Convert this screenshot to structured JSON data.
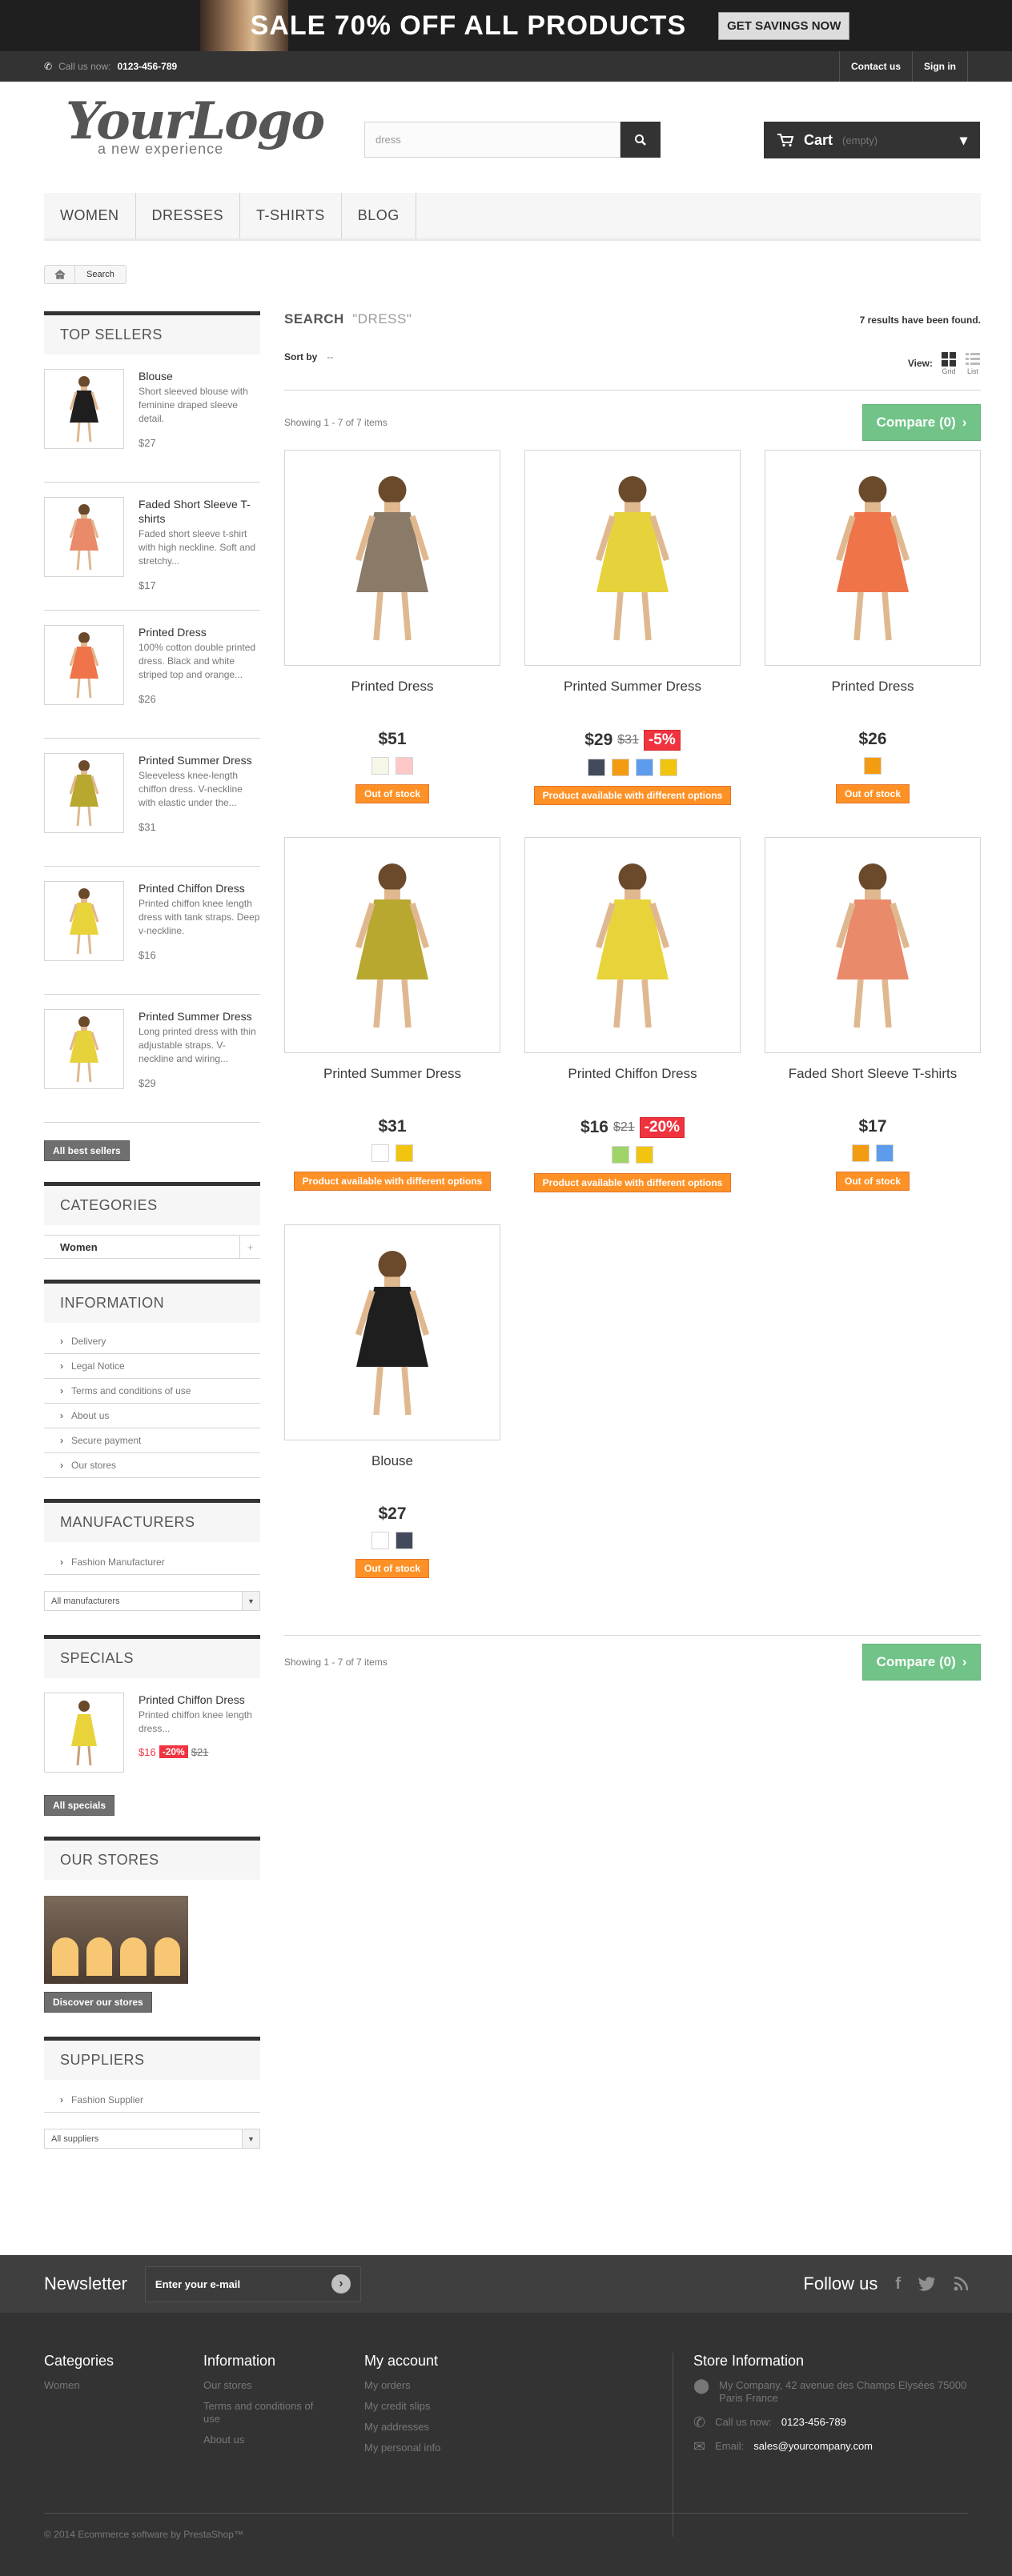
{
  "banner": {
    "text": "SALE 70% OFF ALL PRODUCTS",
    "button": "GET SAVINGS NOW"
  },
  "topbar": {
    "call_label": "Call us now:",
    "phone": "0123-456-789",
    "contact": "Contact us",
    "signin": "Sign in"
  },
  "logo": {
    "main": "YourLogo",
    "tagline": "a new experience"
  },
  "search": {
    "value": "dress"
  },
  "cart": {
    "label": "Cart",
    "status": "(empty)"
  },
  "nav": [
    "WOMEN",
    "DRESSES",
    "T-SHIRTS",
    "BLOG"
  ],
  "breadcrumb": {
    "current": "Search"
  },
  "top_sellers": {
    "title": "TOP SELLERS",
    "button": "All best sellers",
    "items": [
      {
        "name": "Blouse",
        "desc": "Short sleeved blouse with feminine draped sleeve detail.",
        "price": "$27"
      },
      {
        "name": "Faded Short Sleeve T-shirts",
        "desc": "Faded short sleeve t-shirt with high neckline. Soft and stretchy...",
        "price": "$17"
      },
      {
        "name": "Printed Dress",
        "desc": "100% cotton double printed dress. Black and white striped top and orange...",
        "price": "$26"
      },
      {
        "name": "Printed Summer Dress",
        "desc": "Sleeveless knee-length chiffon dress. V-neckline with elastic under the...",
        "price": "$31"
      },
      {
        "name": "Printed Chiffon Dress",
        "desc": "Printed chiffon knee length dress with tank straps. Deep v-neckline.",
        "price": "$16"
      },
      {
        "name": "Printed Summer Dress",
        "desc": "Long printed dress with thin adjustable straps. V-neckline and wiring...",
        "price": "$29"
      }
    ]
  },
  "categories": {
    "title": "CATEGORIES",
    "items": [
      "Women"
    ]
  },
  "information": {
    "title": "INFORMATION",
    "items": [
      "Delivery",
      "Legal Notice",
      "Terms and conditions of use",
      "About us",
      "Secure payment",
      "Our stores"
    ]
  },
  "manufacturers": {
    "title": "MANUFACTURERS",
    "items": [
      "Fashion Manufacturer"
    ],
    "select": "All manufacturers"
  },
  "specials": {
    "title": "SPECIALS",
    "name": "Printed Chiffon Dress",
    "desc": "Printed chiffon knee length dress...",
    "price": "$16",
    "discount": "-20%",
    "old": "$21",
    "button": "All specials"
  },
  "stores": {
    "title": "OUR STORES",
    "button": "Discover our stores"
  },
  "suppliers": {
    "title": "SUPPLIERS",
    "items": [
      "Fashion Supplier"
    ],
    "select": "All suppliers"
  },
  "results": {
    "title": "SEARCH",
    "query": "\"DRESS\"",
    "count": "7 results have been found.",
    "sort_label": "Sort by",
    "sort_value": "--",
    "view_label": "View:",
    "grid": "Grid",
    "list": "List",
    "showing": "Showing 1 - 7 of 7 items",
    "compare": "Compare (0)"
  },
  "products": [
    {
      "name": "Printed Dress",
      "price": "$51",
      "old": "",
      "discount": "",
      "swatches": [
        "#f7f7e8",
        "#fcc8c8"
      ],
      "avail": "Out of stock",
      "dress": "#8a7a68"
    },
    {
      "name": "Printed Summer Dress",
      "price": "$29",
      "old": "$31",
      "discount": "-5%",
      "swatches": [
        "#434a5c",
        "#f39c11",
        "#5d9cec",
        "#f1c40f"
      ],
      "avail": "Product available with different options",
      "dress": "#e6d23a"
    },
    {
      "name": "Printed Dress",
      "price": "$26",
      "old": "",
      "discount": "",
      "swatches": [
        "#f39c11"
      ],
      "avail": "Out of stock",
      "dress": "#f0744a"
    },
    {
      "name": "Printed Summer Dress",
      "price": "$31",
      "old": "",
      "discount": "",
      "swatches": [
        "#ffffff",
        "#f1c40f"
      ],
      "avail": "Product available with different options",
      "dress": "#b8a830"
    },
    {
      "name": "Printed Chiffon Dress",
      "price": "$16",
      "old": "$21",
      "discount": "-20%",
      "swatches": [
        "#a0d468",
        "#f1c40f"
      ],
      "avail": "Product available with different options",
      "dress": "#e8d43a"
    },
    {
      "name": "Faded Short Sleeve T-shirts",
      "price": "$17",
      "old": "",
      "discount": "",
      "swatches": [
        "#f39c11",
        "#5d9cec"
      ],
      "avail": "Out of stock",
      "dress": "#e98a6a"
    },
    {
      "name": "Blouse",
      "price": "$27",
      "old": "",
      "discount": "",
      "swatches": [
        "#ffffff",
        "#434a5c"
      ],
      "avail": "Out of stock",
      "dress": "#1e1e1e"
    }
  ],
  "newsletter": {
    "title": "Newsletter",
    "placeholder": "Enter your e-mail",
    "follow": "Follow us"
  },
  "footer": {
    "categories": {
      "title": "Categories",
      "items": [
        "Women"
      ]
    },
    "information": {
      "title": "Information",
      "items": [
        "Our stores",
        "Terms and conditions of use",
        "About us"
      ]
    },
    "account": {
      "title": "My account",
      "items": [
        "My orders",
        "My credit slips",
        "My addresses",
        "My personal info"
      ]
    },
    "store": {
      "title": "Store Information",
      "address": "My Company, 42 avenue des Champs Elysées 75000 Paris France",
      "call_label": "Call us now:",
      "phone": "0123-456-789",
      "email_label": "Email:",
      "email": "sales@yourcompany.com"
    },
    "copyright": "© 2014 Ecommerce software by PrestaShop™"
  }
}
